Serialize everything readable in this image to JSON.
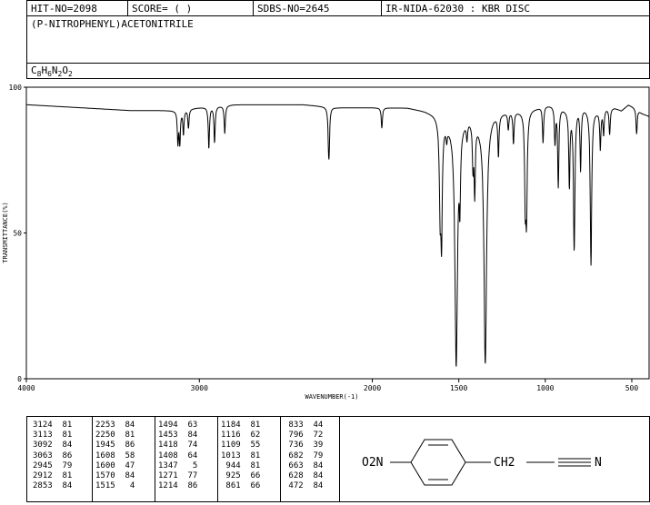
{
  "header": {
    "hit_no": "HIT-NO=2098",
    "score": "SCORE=  (   )",
    "sdbs_no": "SDBS-NO=2645",
    "ir_id": "IR-NIDA-62030 : KBR DISC"
  },
  "compound": {
    "name": "(P-NITROPHENYL)ACETONITRILE",
    "formula_parts": [
      {
        "t": "C",
        "sub": false
      },
      {
        "t": "8",
        "sub": true
      },
      {
        "t": "H",
        "sub": false
      },
      {
        "t": "6",
        "sub": true
      },
      {
        "t": "N",
        "sub": false
      },
      {
        "t": "2",
        "sub": true
      },
      {
        "t": "O",
        "sub": false
      },
      {
        "t": "2",
        "sub": true
      }
    ]
  },
  "chart_data": {
    "type": "line",
    "xlabel": "WAVENUMBER(-1)",
    "ylabel": "TRANSMITTANCE(%)",
    "xlim": [
      4000,
      400
    ],
    "ylim": [
      0,
      100
    ],
    "x_ticks": [
      {
        "v": 4000,
        "label": "4000"
      },
      {
        "v": 3000,
        "label": "3000"
      },
      {
        "v": 2000,
        "label": "2000"
      },
      {
        "v": 1500,
        "label": "1500"
      },
      {
        "v": 1000,
        "label": "1000"
      },
      {
        "v": 500,
        "label": "500"
      }
    ],
    "y_ticks": [
      {
        "v": 0,
        "label": "0"
      },
      {
        "v": 50,
        "label": "50"
      },
      {
        "v": 100,
        "label": "100"
      }
    ],
    "baseline": [
      [
        4000,
        94
      ],
      [
        3700,
        93
      ],
      [
        3400,
        92
      ],
      [
        3150,
        92
      ],
      [
        3000,
        93
      ],
      [
        2800,
        94
      ],
      [
        2600,
        94
      ],
      [
        2400,
        94
      ],
      [
        2200,
        93
      ],
      [
        2000,
        93
      ],
      [
        1800,
        93
      ],
      [
        1700,
        92
      ],
      [
        1640,
        91
      ],
      [
        1560,
        88
      ],
      [
        1500,
        89
      ],
      [
        1440,
        90
      ],
      [
        1380,
        88
      ],
      [
        1300,
        91
      ],
      [
        1200,
        92
      ],
      [
        1150,
        92
      ],
      [
        1050,
        93
      ],
      [
        1000,
        94
      ],
      [
        950,
        94
      ],
      [
        900,
        93
      ],
      [
        860,
        92
      ],
      [
        800,
        94
      ],
      [
        760,
        93
      ],
      [
        700,
        92
      ],
      [
        650,
        93
      ],
      [
        600,
        93
      ],
      [
        560,
        92
      ],
      [
        520,
        94
      ],
      [
        480,
        93
      ],
      [
        440,
        91
      ],
      [
        400,
        90
      ]
    ],
    "peaks": [
      {
        "x": 3124,
        "y": 81
      },
      {
        "x": 3113,
        "y": 81
      },
      {
        "x": 3092,
        "y": 84
      },
      {
        "x": 3063,
        "y": 86
      },
      {
        "x": 2945,
        "y": 79
      },
      {
        "x": 2912,
        "y": 81
      },
      {
        "x": 2853,
        "y": 84
      },
      {
        "x": 2253,
        "y": 84
      },
      {
        "x": 2250,
        "y": 81
      },
      {
        "x": 1945,
        "y": 86
      },
      {
        "x": 1608,
        "y": 58
      },
      {
        "x": 1600,
        "y": 47
      },
      {
        "x": 1570,
        "y": 84
      },
      {
        "x": 1515,
        "y": 4
      },
      {
        "x": 1494,
        "y": 63
      },
      {
        "x": 1453,
        "y": 84
      },
      {
        "x": 1418,
        "y": 74
      },
      {
        "x": 1408,
        "y": 64
      },
      {
        "x": 1347,
        "y": 5
      },
      {
        "x": 1271,
        "y": 77
      },
      {
        "x": 1214,
        "y": 86
      },
      {
        "x": 1184,
        "y": 81
      },
      {
        "x": 1116,
        "y": 62
      },
      {
        "x": 1109,
        "y": 55
      },
      {
        "x": 1013,
        "y": 81
      },
      {
        "x": 944,
        "y": 81
      },
      {
        "x": 925,
        "y": 66
      },
      {
        "x": 861,
        "y": 66
      },
      {
        "x": 833,
        "y": 44
      },
      {
        "x": 796,
        "y": 72
      },
      {
        "x": 736,
        "y": 39
      },
      {
        "x": 682,
        "y": 79
      },
      {
        "x": 663,
        "y": 84
      },
      {
        "x": 628,
        "y": 84
      },
      {
        "x": 472,
        "y": 84
      }
    ],
    "peak_table": [
      [
        "3124  81",
        "3113  81",
        "3092  84",
        "3063  86",
        "2945  79",
        "2912  81",
        "2853  84"
      ],
      [
        "2253  84",
        "2250  81",
        "1945  86",
        "1608  58",
        "1600  47",
        "1570  84",
        "1515   4"
      ],
      [
        "1494  63",
        "1453  84",
        "1418  74",
        "1408  64",
        "1347   5",
        "1271  77",
        "1214  86"
      ],
      [
        "1184  81",
        "1116  62",
        "1109  55",
        "1013  81",
        " 944  81",
        " 925  66",
        " 861  66"
      ],
      [
        " 833  44",
        " 796  72",
        " 736  39",
        " 682  79",
        " 663  84",
        " 628  84",
        " 472  84"
      ]
    ]
  },
  "structure": {
    "left_group": "O2N",
    "ch2": "CH2",
    "nitrile_n": "N"
  }
}
